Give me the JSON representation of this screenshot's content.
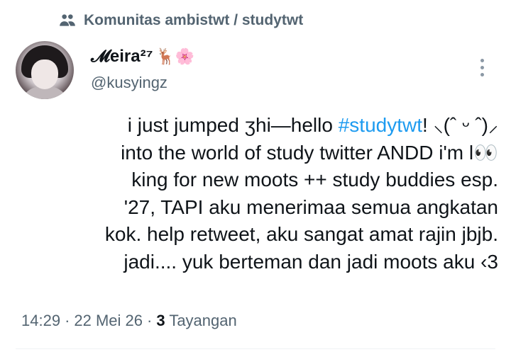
{
  "community": {
    "label": "Komunitas ambistwt / studytwt"
  },
  "author": {
    "name": "𝓜eira²⁷",
    "emojis": "🦌🌸",
    "handle": "@kusyingz"
  },
  "tweet": {
    "line1_pre": "i just jumped ",
    "line1_mid": "ʒhi—hello ",
    "hashtag": "#studytwt",
    "line1_post": "! ⸜(ˆ ᵕ ˆ)⸝",
    "line2": "into the world of study twitter ANDD i'm l👀",
    "line3": "king for new moots ++ study buddies esp.",
    "line4": "'27, TAPI aku menerimaa semua angkatan",
    "line5": "kok. help retweet, aku sangat amat rajin jbjb.",
    "line6": "jadi.... yuk berteman dan jadi moots aku ‹3"
  },
  "meta": {
    "time": "14:29",
    "date": "22 Mei 26",
    "views_count": "3",
    "views_label": "Tayangan",
    "sep": "·"
  },
  "icons": {
    "community": "community-icon",
    "more": "more-options-icon"
  }
}
